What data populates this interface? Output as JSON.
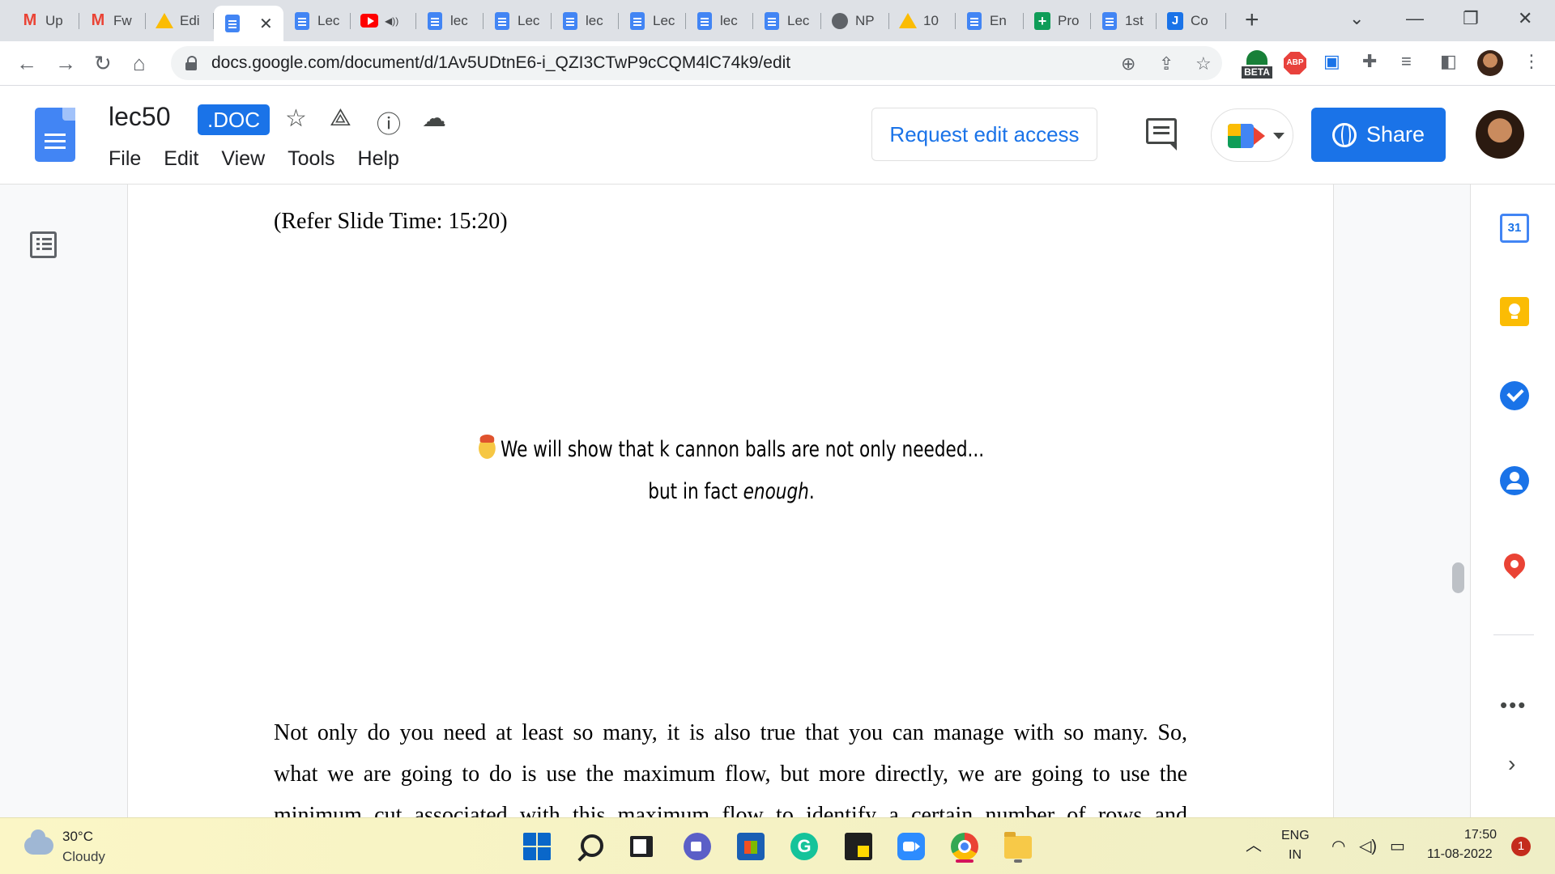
{
  "browser": {
    "tabs": [
      {
        "label": "Up",
        "favicon": "gmail"
      },
      {
        "label": "Fw",
        "favicon": "gmail"
      },
      {
        "label": "Edi",
        "favicon": "drive"
      },
      {
        "label": "",
        "favicon": "docs",
        "active": true
      },
      {
        "label": "Lec",
        "favicon": "docs"
      },
      {
        "label": "",
        "favicon": "youtube"
      },
      {
        "label": "lec",
        "favicon": "docs"
      },
      {
        "label": "Lec",
        "favicon": "docs"
      },
      {
        "label": "lec",
        "favicon": "docs"
      },
      {
        "label": "Lec",
        "favicon": "docs"
      },
      {
        "label": "lec",
        "favicon": "docs"
      },
      {
        "label": "Lec",
        "favicon": "docs"
      },
      {
        "label": "NP",
        "favicon": "globe"
      },
      {
        "label": "10",
        "favicon": "drive"
      },
      {
        "label": "En",
        "favicon": "docs"
      },
      {
        "label": "Pro",
        "favicon": "sheets"
      },
      {
        "label": "1st",
        "favicon": "docs"
      },
      {
        "label": "Co",
        "favicon": "j"
      }
    ],
    "new_tab": "+",
    "close_tab": "✕",
    "url": "docs.google.com/document/d/1Av5UDtnE6-i_QZI3CTwP9cCQM4lC74k9/edit",
    "beta_label": "BETA",
    "abp_label": "ABP"
  },
  "docs": {
    "title": "lec50",
    "badge": ".DOC",
    "menu": [
      "File",
      "Edit",
      "View",
      "Tools",
      "Help"
    ],
    "request_edit": "Request edit access",
    "share": "Share"
  },
  "content": {
    "refer": "(Refer Slide Time: 15:20)",
    "slide_line1": "We will show that k cannon balls are not only needed...",
    "slide_line2_prefix": "but in fact ",
    "slide_line2_em": "enough",
    "slide_line2_suffix": ".",
    "paragraph_lines": [
      "Not only do you need at least so many, it is also true that you can manage with so many. So,",
      "what we are going to do is use the maximum flow, but more directly, we are going to use the",
      "minimum cut associated with this maximum flow to identify a certain number of rows and"
    ]
  },
  "side_panel": {
    "calendar_day": "31",
    "more": "•••",
    "expand": "›"
  },
  "taskbar": {
    "temperature": "30°C",
    "condition": "Cloudy",
    "grammarly_letter": "G",
    "lang_top": "ENG",
    "lang_bottom": "IN",
    "time": "17:50",
    "date": "11-08-2022",
    "notification_count": "1"
  }
}
